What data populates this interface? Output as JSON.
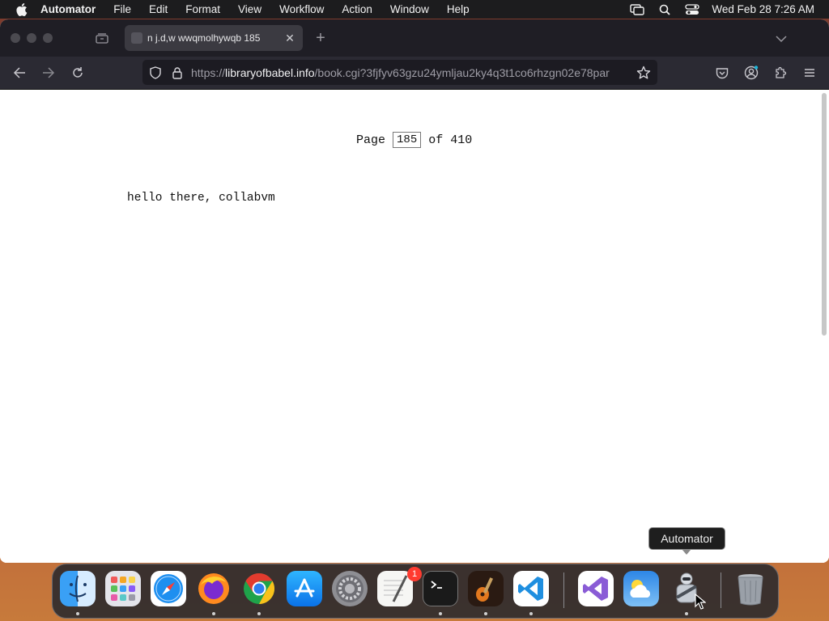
{
  "menubar": {
    "app": "Automator",
    "items": [
      "File",
      "Edit",
      "Format",
      "View",
      "Workflow",
      "Action",
      "Window",
      "Help"
    ],
    "clock": "Wed Feb 28  7:26 AM"
  },
  "browser": {
    "tab_title": "n j.d,w wwqmolhywqb 185",
    "url_prefix": "https://",
    "url_domain": "libraryofbabel.info",
    "url_path": "/book.cgi?3fjfyv63gzu24ymljau2ky4q3t1co6rhzgn02e78par"
  },
  "page": {
    "page_label": "Page",
    "page_number": "185",
    "of_label": "of 410",
    "text": "hello there, collabvm"
  },
  "dock": {
    "tooltip": "Automator",
    "badge_count": "1",
    "apps": [
      "finder",
      "launchpad",
      "safari",
      "firefox",
      "chrome",
      "app-store",
      "system-settings",
      "textedit",
      "terminal",
      "garageband",
      "vscode",
      "visual-studio",
      "weather",
      "automator",
      "trash"
    ]
  }
}
